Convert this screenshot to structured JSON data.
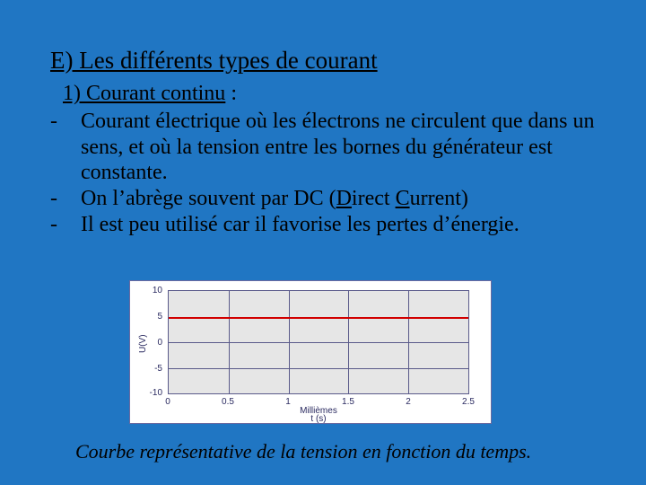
{
  "heading": "E) Les différents types de courant",
  "subheading": "1) Courant continu",
  "subcolon": " :",
  "bullets": {
    "b1": "Courant électrique où les électrons ne circulent que dans un sens, et où la tension entre les bornes du générateur est constante.",
    "b2a": "On l’abrège souvent par DC (",
    "b2b": "D",
    "b2c": "irect ",
    "b2d": "C",
    "b2e": "urrent)",
    "b3": "Il est peu utilisé car il favorise les pertes d’énergie."
  },
  "caption": "Courbe représentative de la tension en fonction du temps.",
  "chart_data": {
    "type": "line",
    "x": [
      0,
      0.5,
      1,
      1.5,
      2,
      2.5
    ],
    "y": [
      5,
      5,
      5,
      5,
      5,
      5
    ],
    "x_ticks": [
      "0",
      "0.5",
      "1",
      "1.5",
      "2",
      "2.5"
    ],
    "y_ticks": [
      "-10",
      "-5",
      "0",
      "5",
      "10"
    ],
    "xlabel_top": "Millièmes",
    "xlabel_bottom": "t (s)",
    "ylabel": "U(V)",
    "xlim": [
      0,
      2.5
    ],
    "ylim": [
      -10,
      10
    ],
    "grid": true,
    "line_color": "#d20000",
    "title": ""
  }
}
